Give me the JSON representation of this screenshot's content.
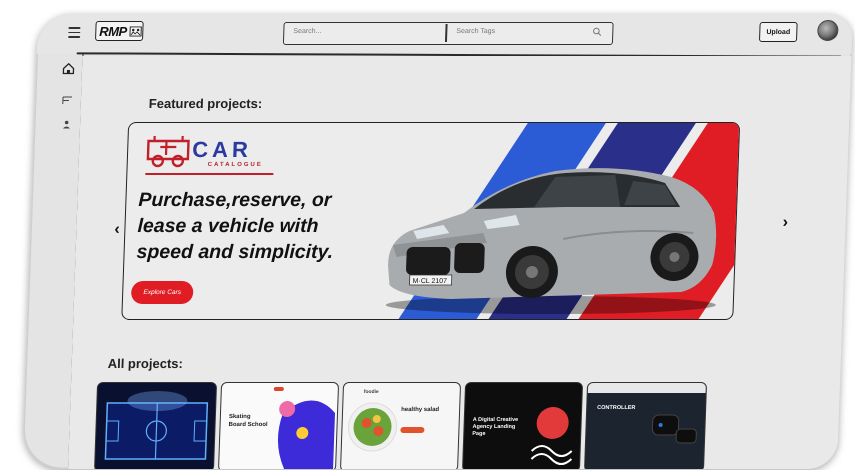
{
  "header": {
    "logo_text": "RMP",
    "search_placeholder": "Search...",
    "tags_placeholder": "Search Tags",
    "upload_label": "Upload"
  },
  "featured": {
    "title": "Featured projects:",
    "brand_name": "CAR",
    "brand_sub": "CATALOGUE",
    "headline_1": "Purchase,reserve, or",
    "headline_2": "lease a vehicle with",
    "headline_3": "speed and simplicity.",
    "cta_label": "Explore Cars",
    "plate": "M·CL 2107"
  },
  "all_projects": {
    "title": "All projects:",
    "cards": [
      {
        "name": "soccer-field"
      },
      {
        "name": "skating-board-school",
        "title": "Skating Board School"
      },
      {
        "name": "healthy-salad",
        "brand": "foodie",
        "title": "healthy salad"
      },
      {
        "name": "creative-agency",
        "title": "A Digital Creative Agency Landing Page"
      },
      {
        "name": "controller",
        "title": "CONTROLLER"
      }
    ]
  },
  "colors": {
    "accent_red": "#e01d25",
    "brand_blue": "#2a3aa0",
    "stripe_blue": "#2c5bd6",
    "stripe_navy": "#2a2f8a"
  }
}
